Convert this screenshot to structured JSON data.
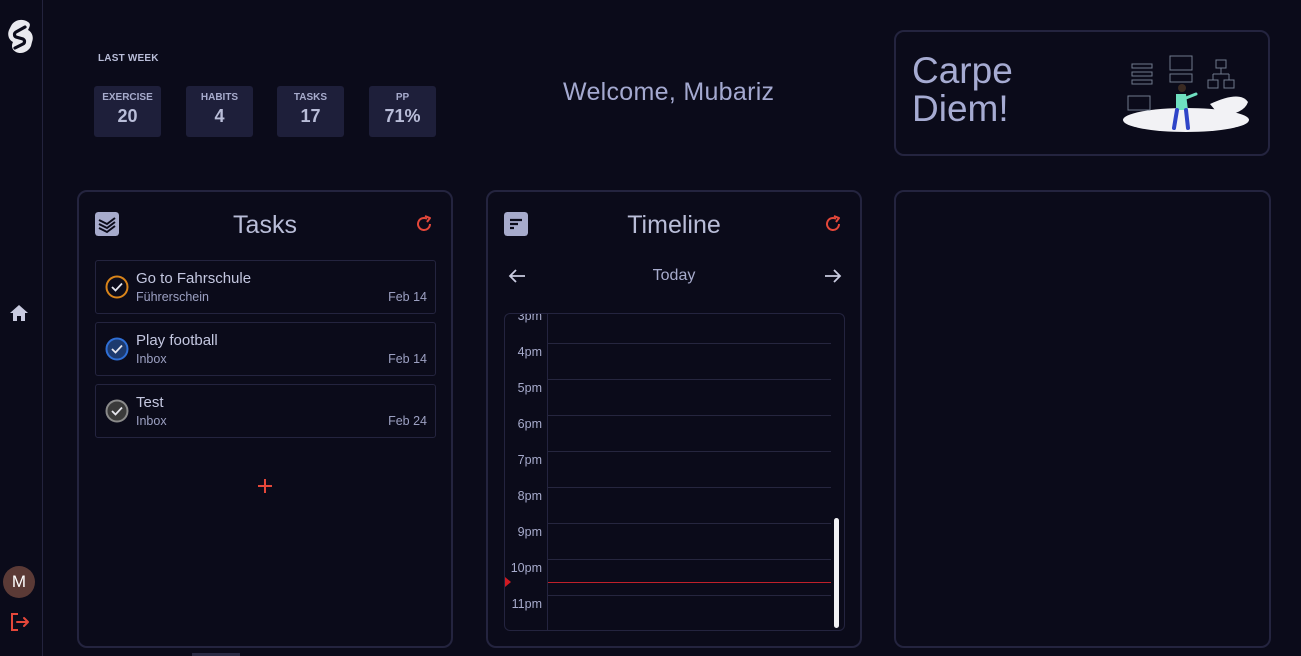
{
  "sidebar": {
    "avatar_initial": "M"
  },
  "stats": {
    "heading": "LAST WEEK",
    "items": [
      {
        "label": "EXERCISE",
        "value": "20"
      },
      {
        "label": "HABITS",
        "value": "4"
      },
      {
        "label": "TASKS",
        "value": "17"
      },
      {
        "label": "PP",
        "value": "71%"
      }
    ]
  },
  "welcome": "Welcome, Mubariz",
  "quote": {
    "line1": "Carpe",
    "line2": "Diem!"
  },
  "tasks": {
    "title": "Tasks",
    "items": [
      {
        "title": "Go to Fahrschule",
        "project": "Führerschein",
        "date": "Feb 14",
        "color": "#d9841a"
      },
      {
        "title": "Play football",
        "project": "Inbox",
        "date": "Feb 14",
        "color": "#2f6fd6"
      },
      {
        "title": "Test",
        "project": "Inbox",
        "date": "Feb 24",
        "color": "#8a8a8a"
      }
    ]
  },
  "timeline": {
    "title": "Timeline",
    "day": "Today",
    "hours": [
      "3pm",
      "4pm",
      "5pm",
      "6pm",
      "7pm",
      "8pm",
      "9pm",
      "10pm",
      "11pm"
    ]
  },
  "colors": {
    "accent": "#e4473a",
    "background": "#0b0b1a",
    "card": "#1e1f3a",
    "now_line": "#c0202a"
  },
  "icons": {
    "logo": "svelte-logo-icon",
    "home": "home-icon",
    "logout": "logout-icon",
    "refresh": "refresh-icon",
    "add": "plus-icon",
    "prev": "arrow-left-icon",
    "next": "arrow-right-icon"
  }
}
